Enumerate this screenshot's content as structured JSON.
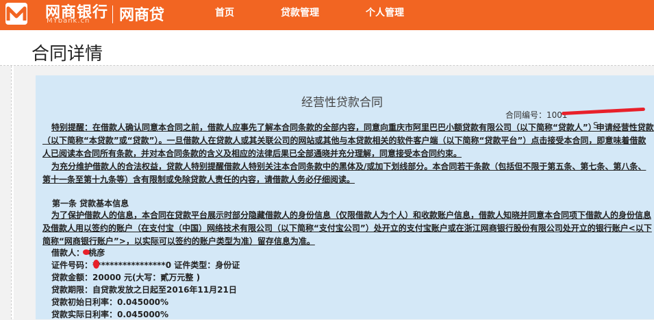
{
  "header": {
    "brand_name": "网商银行",
    "brand_sub": "MYbank.cn",
    "product": "网商贷",
    "nav": [
      "首页",
      "贷款管理",
      "个人管理"
    ]
  },
  "page": {
    "title": "合同详情"
  },
  "contract": {
    "title": "经营性贷款合同",
    "number_label": "合同编号：",
    "number_visible": "1001",
    "number_tail": "S",
    "p1": "特别提醒：在借款人确认同意本合同之前，借款人应事先了解本合同条款的全部内容，同意向重庆市阿里巴巴小额贷款有限公司（以下简称“贷款人”）申请经营性贷款（以下简称“本贷款”或“贷款”）。一旦借款人在贷款人或其关联公司的网站或其他与本贷款相关的软件客户端（以下简称“贷款平台”）点击接受本合同，即意味着借款人已阅读本合同所有条款，并对本合同条款的含义及相应的法律后果已全部通晓并充分理解，同意接受本合同约束。",
    "p2": "为充分维护借款人的合法权益，贷款人特别提醒借款人特别关注本合同条款中的黑体及/或加下划线部分。本合同若干条款（包括但不限于第五条、第七条、第八条、第十一条至第十九条等）含有限制或免除贷款人责任的内容，请借款人务必仔细阅读。",
    "section1_title": "第一条 贷款基本信息",
    "p3": "为了保护借款人的信息，本合同在贷款平台展示时部分隐藏借款人的身份信息（仅限借款人为个人）和收款账户信息，借款人知晓并同意本合同项下借款人的身份信息及借款人用以签约的账户（在支付宝（中国）网络技术有限公司（以下简称“支付宝公司”）处开立的支付宝账户或在浙江网商银行股份有限公司处开立的银行账户<以下简称“网商银行账户”>，以实际可以签约的账户类型为准）留存信息为准。",
    "fields": {
      "borrower_label": "借款人：",
      "borrower_value": "*桃彦",
      "id_label": "证件号码：",
      "id_value": "*****************0",
      "id_type_label": " 证件类型：",
      "id_type_value": "身份证",
      "amount_label": "贷款金额：",
      "amount_value": "20000 元(大写：貳万元整 )",
      "term_label": "贷款期限：",
      "term_value": "自贷款发放之日起至2016年11月21日",
      "init_rate_label": "贷款初始日利率：",
      "init_rate_value": "0.045000%",
      "actual_rate_label": "贷款实际日利率：",
      "actual_rate_value": "0.045000%"
    }
  },
  "colors": {
    "brand_orange": "#f26522",
    "paper_blue": "#d4e8f7",
    "redaction_red": "#e8202a"
  }
}
